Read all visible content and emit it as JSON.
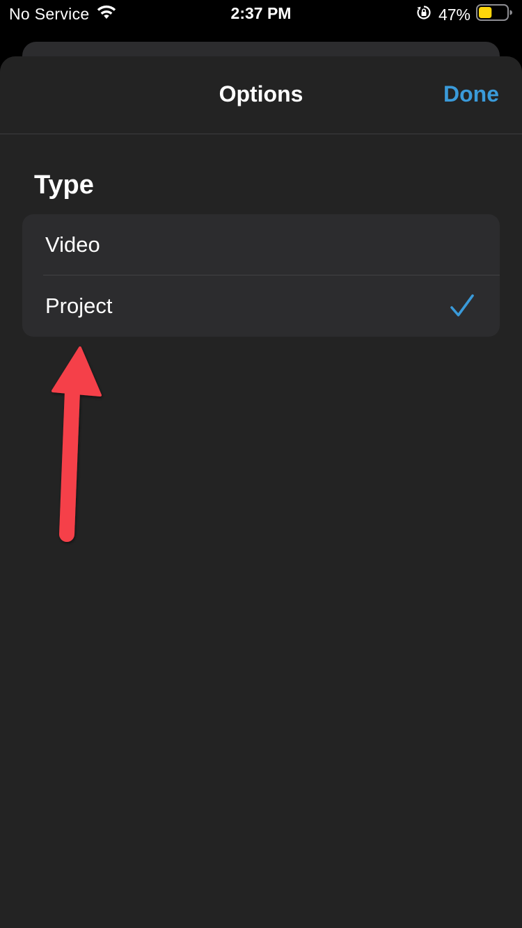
{
  "status_bar": {
    "carrier": "No Service",
    "time": "2:37 PM",
    "battery_percent": "47%",
    "battery_level": 0.47,
    "icons": [
      "wifi-icon",
      "lock-rotation-icon",
      "battery-icon"
    ]
  },
  "nav": {
    "title": "Options",
    "done_label": "Done"
  },
  "section": {
    "title": "Type",
    "options": [
      {
        "label": "Video",
        "selected": false
      },
      {
        "label": "Project",
        "selected": true
      }
    ]
  },
  "annotation": {
    "icon": "red-arrow-icon",
    "color": "#f5404a"
  },
  "colors": {
    "accent": "#3a9ad9",
    "sheet_background": "#232323",
    "group_background": "#2c2c2e",
    "battery_fill": "#ffd60a"
  }
}
